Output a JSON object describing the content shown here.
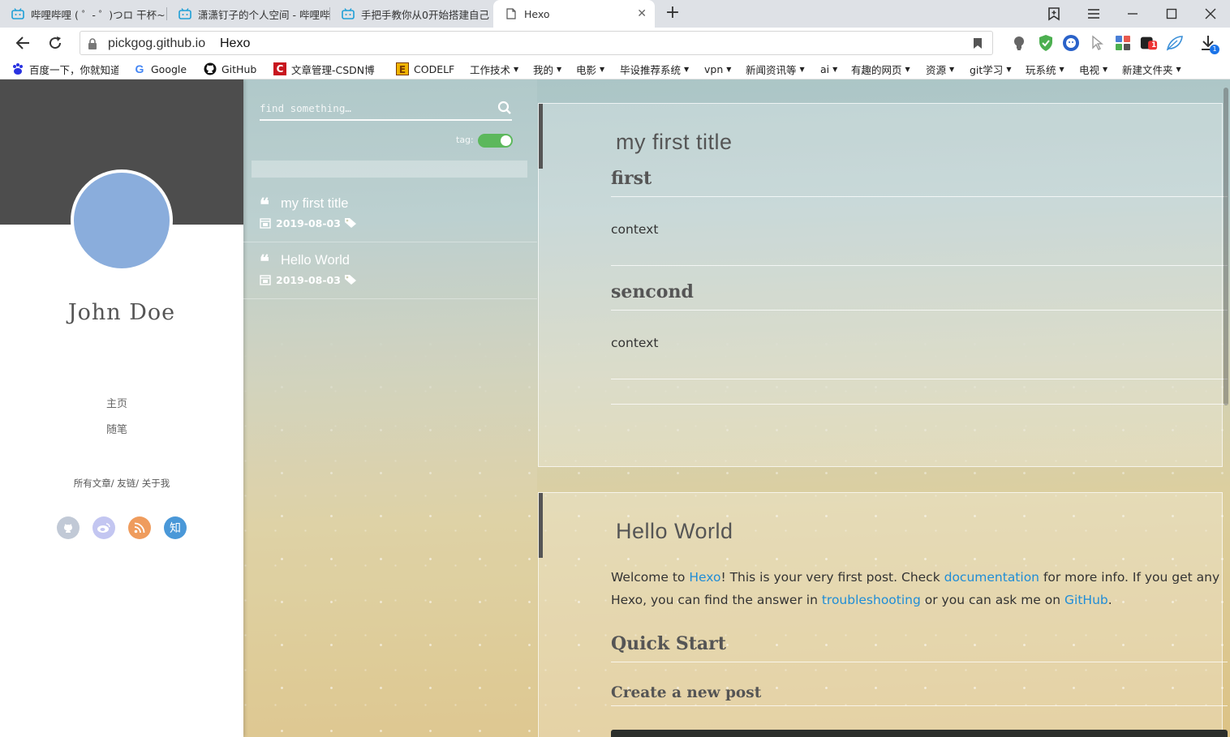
{
  "browser": {
    "tabs": [
      {
        "title": "哔哩哔哩 ( ゜- ゜)つロ 干杯~"
      },
      {
        "title": "潇潇钉子的个人空间 - 哔哩哔"
      },
      {
        "title": "手把手教你从0开始搭建自己"
      },
      {
        "title": "Hexo",
        "active": true
      }
    ],
    "new_tab": "+",
    "url": "pickgog.github.io",
    "page_title": "Hexo",
    "download_badge": "1",
    "ext_badge": "1",
    "bookmarks": [
      {
        "label": "百度一下，你就知道",
        "icon": "baidu-icon"
      },
      {
        "label": "Google",
        "icon": "google-icon"
      },
      {
        "label": "GitHub",
        "icon": "github-icon"
      },
      {
        "label": "文章管理-CSDN博",
        "icon": "csdn-icon"
      },
      {
        "label": "CODELF",
        "icon": "codelf-icon"
      },
      {
        "label": "工作技术",
        "folder": true
      },
      {
        "label": "我的",
        "folder": true
      },
      {
        "label": "电影",
        "folder": true
      },
      {
        "label": "毕设推荐系统",
        "folder": true
      },
      {
        "label": "vpn",
        "folder": true
      },
      {
        "label": "新闻资讯等",
        "folder": true
      },
      {
        "label": "ai",
        "folder": true
      },
      {
        "label": "有趣的网页",
        "folder": true
      },
      {
        "label": "资源",
        "folder": true
      },
      {
        "label": "git学习",
        "folder": true
      },
      {
        "label": "玩系统",
        "folder": true
      },
      {
        "label": "电视",
        "folder": true
      },
      {
        "label": "新建文件夹",
        "folder": true
      }
    ]
  },
  "sidebar": {
    "author": "John Doe",
    "nav": [
      "主页",
      "随笔"
    ],
    "links": {
      "all": "所有文章",
      "sep": "/",
      "friends": "友链",
      "about": "关于我"
    },
    "social": [
      {
        "icon": "github-icon",
        "color": "#c1c9d6"
      },
      {
        "icon": "weibo-icon",
        "color": "#c3c6f1"
      },
      {
        "icon": "rss-icon",
        "color": "#ef9c5d"
      },
      {
        "icon": "zhihu-icon",
        "color": "#4a98d8",
        "glyph": "知"
      }
    ]
  },
  "postlist": {
    "search_placeholder": "find something…",
    "tag_label": "tag:",
    "tag_toggle_on": true,
    "posts": [
      {
        "title": "my first title",
        "date": "2019-08-03"
      },
      {
        "title": "Hello World",
        "date": "2019-08-03"
      }
    ]
  },
  "articles": [
    {
      "title": "my first title",
      "sections": [
        {
          "heading": "first",
          "text": "context"
        },
        {
          "heading": "sencond",
          "text": "context"
        }
      ]
    },
    {
      "title": "Hello World",
      "intro": {
        "t1": "Welcome to ",
        "l1": "Hexo",
        "t2": "! This is your very first post. Check ",
        "l2": "documentation",
        "t3": " for more info. If you get any",
        "t4": "Hexo, you can find the answer in ",
        "l3": "troubleshooting",
        "t5": " or you can ask me on ",
        "l4": "GitHub",
        "t6": "."
      },
      "h2": "Quick Start",
      "h3": "Create a new post"
    }
  ],
  "colors": {
    "accent_link": "#1f8dd6",
    "toggle": "#5cb85c",
    "avatar": "#8aaddc"
  }
}
